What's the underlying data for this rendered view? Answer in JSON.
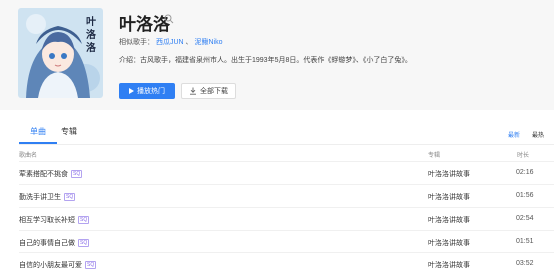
{
  "artist": {
    "name": "叶洛洛",
    "similar_label": "相似歌手：",
    "similar": [
      "西瓜JUN",
      "泥鳅Niko"
    ],
    "similar_sep": "、",
    "bio": "介绍：古风歌手，福建省泉州市人。出生于1993年5月8日。代表作《蜉蝣梦》、《小了白了兔》。",
    "cover_text": "叶洛洛"
  },
  "buttons": {
    "play_hot": "播放热门",
    "download_all": "全部下载"
  },
  "tabs": [
    {
      "label": "单曲",
      "active": true
    },
    {
      "label": "专辑",
      "active": false
    }
  ],
  "sort": {
    "newest": "最新",
    "hottest": "最热"
  },
  "columns": {
    "name": "歌曲名",
    "album": "专辑",
    "duration": "时长"
  },
  "songs": [
    {
      "title": "荤素搭配不挑食",
      "badge": "SQ",
      "album": "叶洛洛讲故事",
      "duration": "02:16"
    },
    {
      "title": "勤洗手讲卫生",
      "badge": "SQ",
      "album": "叶洛洛讲故事",
      "duration": "01:56"
    },
    {
      "title": "相互学习取长补短",
      "badge": "SQ",
      "album": "叶洛洛讲故事",
      "duration": "02:54"
    },
    {
      "title": "自己的事情自己做",
      "badge": "SQ",
      "album": "叶洛洛讲故事",
      "duration": "01:51"
    },
    {
      "title": "自信的小朋友最可爱",
      "badge": "SQ",
      "album": "叶洛洛讲故事",
      "duration": "03:52"
    }
  ],
  "colors": {
    "accent": "#2f7ff3",
    "sq_badge": "#8a6de9",
    "hero_bg": "#f7f7f7"
  }
}
